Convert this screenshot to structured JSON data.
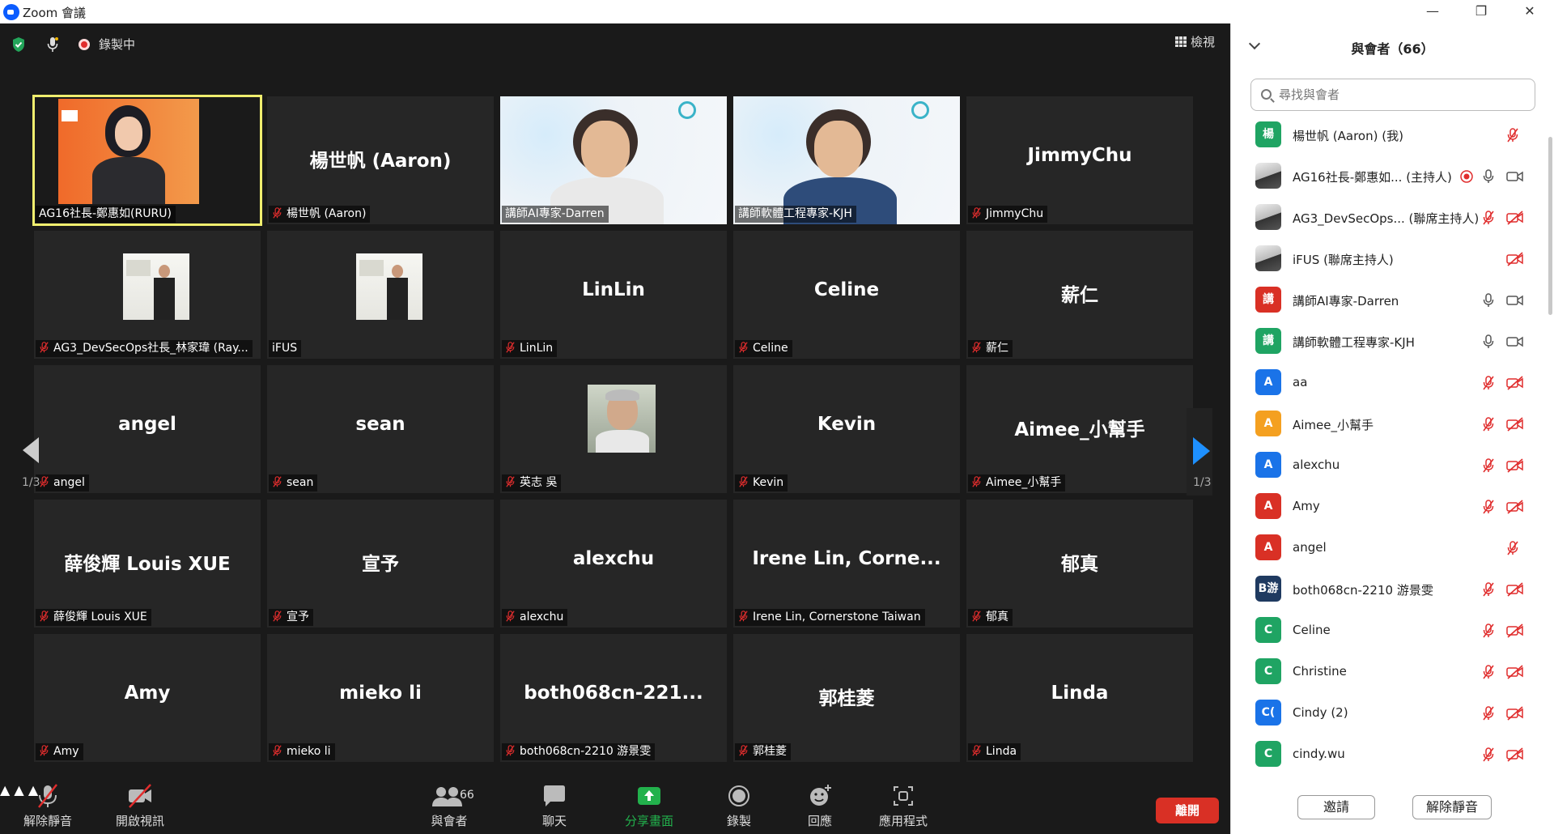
{
  "window": {
    "title": "Zoom 會議"
  },
  "topbar": {
    "recording_label": "錄製中",
    "view_label": "檢視"
  },
  "colors": {
    "accent": "#0b5cff",
    "active_speaker": "#f0ee6e",
    "leave": "#d93025",
    "share_green": "#22b14c"
  },
  "tiles": [
    {
      "big": "",
      "label": "AG16社長-鄭惠如(RURU)",
      "kind": "video-ruru",
      "active": true,
      "muted": false
    },
    {
      "big": "楊世帆 (Aaron)",
      "label": "楊世帆 (Aaron)",
      "kind": "name",
      "muted": true
    },
    {
      "big": "",
      "label": "講師AI專家-Darren",
      "kind": "video-darren",
      "muted": false
    },
    {
      "big": "",
      "label": "講師軟體工程專家-KJH",
      "kind": "video-kjh",
      "muted": false
    },
    {
      "big": "JimmyChu",
      "label": "JimmyChu",
      "kind": "name",
      "muted": true
    },
    {
      "big": "",
      "label": "AG3_DevSecOps社長_林家瑋 (Ray...",
      "kind": "photo",
      "muted": true
    },
    {
      "big": "",
      "label": "iFUS",
      "kind": "photo",
      "muted": false
    },
    {
      "big": "LinLin",
      "label": "LinLin",
      "kind": "name",
      "muted": true
    },
    {
      "big": "Celine",
      "label": "Celine",
      "kind": "name",
      "muted": true
    },
    {
      "big": "薪仁",
      "label": "薪仁",
      "kind": "name",
      "muted": true
    },
    {
      "big": "angel",
      "label": "angel",
      "kind": "name",
      "muted": true
    },
    {
      "big": "sean",
      "label": "sean",
      "kind": "name",
      "muted": true
    },
    {
      "big": "",
      "label": "英志 吳",
      "kind": "photo-man",
      "muted": true
    },
    {
      "big": "Kevin",
      "label": "Kevin",
      "kind": "name",
      "muted": true
    },
    {
      "big": "Aimee_小幫手",
      "label": "Aimee_小幫手",
      "kind": "name",
      "muted": true
    },
    {
      "big": "薛俊輝 Louis XUE",
      "label": "薛俊輝 Louis XUE",
      "kind": "name",
      "muted": true
    },
    {
      "big": "宣予",
      "label": "宣予",
      "kind": "name",
      "muted": true
    },
    {
      "big": "alexchu",
      "label": "alexchu",
      "kind": "name",
      "muted": true
    },
    {
      "big": "Irene Lin, Corne...",
      "label": "Irene Lin, Cornerstone Taiwan",
      "kind": "name",
      "muted": true
    },
    {
      "big": "郁真",
      "label": "郁真",
      "kind": "name",
      "muted": true
    },
    {
      "big": "Amy",
      "label": "Amy",
      "kind": "name",
      "muted": true
    },
    {
      "big": "mieko li",
      "label": "mieko li",
      "kind": "name",
      "muted": true
    },
    {
      "big": "both068cn-221...",
      "label": "both068cn-2210 游景雯",
      "kind": "name",
      "muted": true
    },
    {
      "big": "郭桂菱",
      "label": "郭桂菱",
      "kind": "name",
      "muted": true
    },
    {
      "big": "Linda",
      "label": "Linda",
      "kind": "name",
      "muted": true
    }
  ],
  "pager": {
    "left": "1/3",
    "right": "1/3"
  },
  "toolbar": {
    "unmute": "解除靜音",
    "start_video": "開啟視訊",
    "participants": "與會者",
    "participants_count": "66",
    "chat": "聊天",
    "share": "分享畫面",
    "record": "錄製",
    "reactions": "回應",
    "apps": "應用程式",
    "leave": "離開"
  },
  "panel": {
    "title": "與會者（66）",
    "search_placeholder": "尋找與會者",
    "participants": [
      {
        "avatar": "楊",
        "color": "#1fa463",
        "name": "楊世帆 (Aaron) (我)",
        "icons": [
          "mic-muted"
        ]
      },
      {
        "avatar": "",
        "color": "photo",
        "name": "AG16社長-鄭惠如... (主持人)",
        "icons": [
          "recording",
          "mic",
          "video"
        ]
      },
      {
        "avatar": "",
        "color": "photo",
        "name": "AG3_DevSecOps...   (聯席主持人)",
        "icons": [
          "mic-muted",
          "video-off"
        ]
      },
      {
        "avatar": "",
        "color": "photo",
        "name": "iFUS (聯席主持人)",
        "icons": [
          "video-off"
        ]
      },
      {
        "avatar": "講",
        "color": "#d93025",
        "name": "講師AI專家-Darren",
        "icons": [
          "mic",
          "video"
        ]
      },
      {
        "avatar": "講",
        "color": "#1fa463",
        "name": "講師軟體工程專家-KJH",
        "icons": [
          "mic",
          "video"
        ]
      },
      {
        "avatar": "A",
        "color": "#1a73e8",
        "name": "aa",
        "icons": [
          "mic-muted",
          "video-off"
        ]
      },
      {
        "avatar": "A",
        "color": "#f4a020",
        "name": "Aimee_小幫手",
        "icons": [
          "mic-muted",
          "video-off"
        ]
      },
      {
        "avatar": "A",
        "color": "#1a73e8",
        "name": "alexchu",
        "icons": [
          "mic-muted",
          "video-off"
        ]
      },
      {
        "avatar": "A",
        "color": "#d93025",
        "name": "Amy",
        "icons": [
          "mic-muted",
          "video-off"
        ]
      },
      {
        "avatar": "A",
        "color": "#d93025",
        "name": "angel",
        "icons": [
          "mic-muted"
        ]
      },
      {
        "avatar": "B游",
        "color": "#1f3a60",
        "name": "both068cn-2210 游景雯",
        "icons": [
          "mic-muted",
          "video-off"
        ]
      },
      {
        "avatar": "C",
        "color": "#1fa463",
        "name": "Celine",
        "icons": [
          "mic-muted",
          "video-off"
        ]
      },
      {
        "avatar": "C",
        "color": "#1fa463",
        "name": "Christine",
        "icons": [
          "mic-muted",
          "video-off"
        ]
      },
      {
        "avatar": "C(",
        "color": "#1a73e8",
        "name": "Cindy (2)",
        "icons": [
          "mic-muted",
          "video-off"
        ]
      },
      {
        "avatar": "C",
        "color": "#1fa463",
        "name": "cindy.wu",
        "icons": [
          "mic-muted",
          "video-off"
        ]
      }
    ],
    "invite": "邀請",
    "unmute": "解除靜音"
  }
}
